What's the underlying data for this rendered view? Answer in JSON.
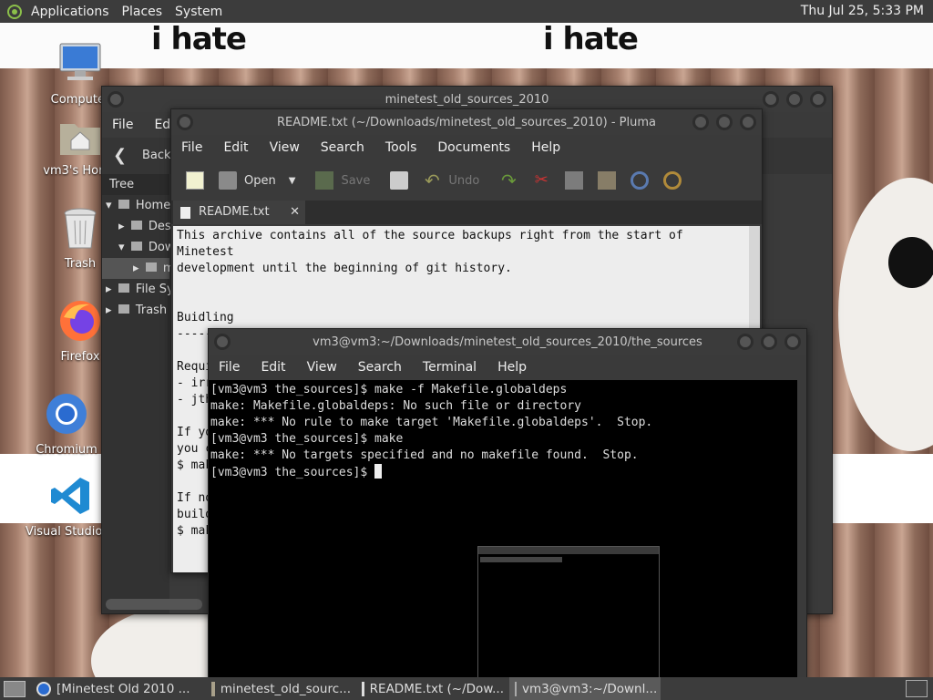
{
  "top_panel": {
    "menus": [
      "Applications",
      "Places",
      "System"
    ],
    "clock": "Thu Jul 25,  5:33 PM"
  },
  "wallpaper": {
    "caption_left": "i hate",
    "caption_right": "i hate"
  },
  "desktop_icons": [
    {
      "label": "Computer",
      "icon": "computer-icon"
    },
    {
      "label": "vm3's Home",
      "icon": "home-folder-icon"
    },
    {
      "label": "Trash",
      "icon": "trash-icon"
    },
    {
      "label": "Firefox",
      "icon": "firefox-icon"
    },
    {
      "label": "Chromium",
      "icon": "chromium-icon"
    },
    {
      "label": "Visual Studio Code",
      "icon": "vscode-icon"
    }
  ],
  "file_manager": {
    "title": "minetest_old_sources_2010",
    "menus": [
      "File",
      "Edit"
    ],
    "back_label": "Back",
    "sidebar_mode": "Tree",
    "tree": [
      {
        "label": "Home",
        "expanded": true
      },
      {
        "label": "Desktop",
        "expanded": false
      },
      {
        "label": "Downloads",
        "expanded": true
      },
      {
        "label": "minetest_old_sources_2010",
        "expanded": false
      },
      {
        "label": "File System",
        "expanded": false
      },
      {
        "label": "Trash",
        "expanded": false
      }
    ]
  },
  "pluma": {
    "title": "README.txt (~/Downloads/minetest_old_sources_2010) - Pluma",
    "menus": [
      "File",
      "Edit",
      "View",
      "Search",
      "Tools",
      "Documents",
      "Help"
    ],
    "toolbar": {
      "open": "Open",
      "save": "Save",
      "undo": "Undo"
    },
    "tab_label": "README.txt",
    "content": "This archive contains all of the source backups right from the start of\nMinetest\ndevelopment until the beginning of git history.\n\n\nBuidling\n--------\n\nRequi\n- irr\n- jth\n\nIf yo\nyou c\n$ mak\n\nIf no\nbuild\n$ mak"
  },
  "terminal": {
    "title": "vm3@vm3:~/Downloads/minetest_old_sources_2010/the_sources",
    "menus": [
      "File",
      "Edit",
      "View",
      "Search",
      "Terminal",
      "Help"
    ],
    "lines": [
      "[vm3@vm3 the_sources]$ make -f Makefile.globaldeps",
      "make: Makefile.globaldeps: No such file or directory",
      "make: *** No rule to make target 'Makefile.globaldeps'.  Stop.",
      "[vm3@vm3 the_sources]$ make",
      "make: *** No targets specified and no makefile found.  Stop.",
      "[vm3@vm3 the_sources]$ "
    ]
  },
  "taskbar": {
    "tasks": [
      {
        "label": "[Minetest Old 2010 ...",
        "icon": "browser-icon",
        "active": false
      },
      {
        "label": "minetest_old_sourc...",
        "icon": "folder-icon",
        "active": false
      },
      {
        "label": "README.txt (~/Dow...",
        "icon": "text-editor-icon",
        "active": false
      },
      {
        "label": "vm3@vm3:~/Downl...",
        "icon": "terminal-icon",
        "active": true
      }
    ]
  },
  "colors": {
    "panel": "#3c3c3c",
    "window": "#3a3a3a",
    "terminal_bg": "#000000",
    "editor_bg": "#ededed"
  }
}
